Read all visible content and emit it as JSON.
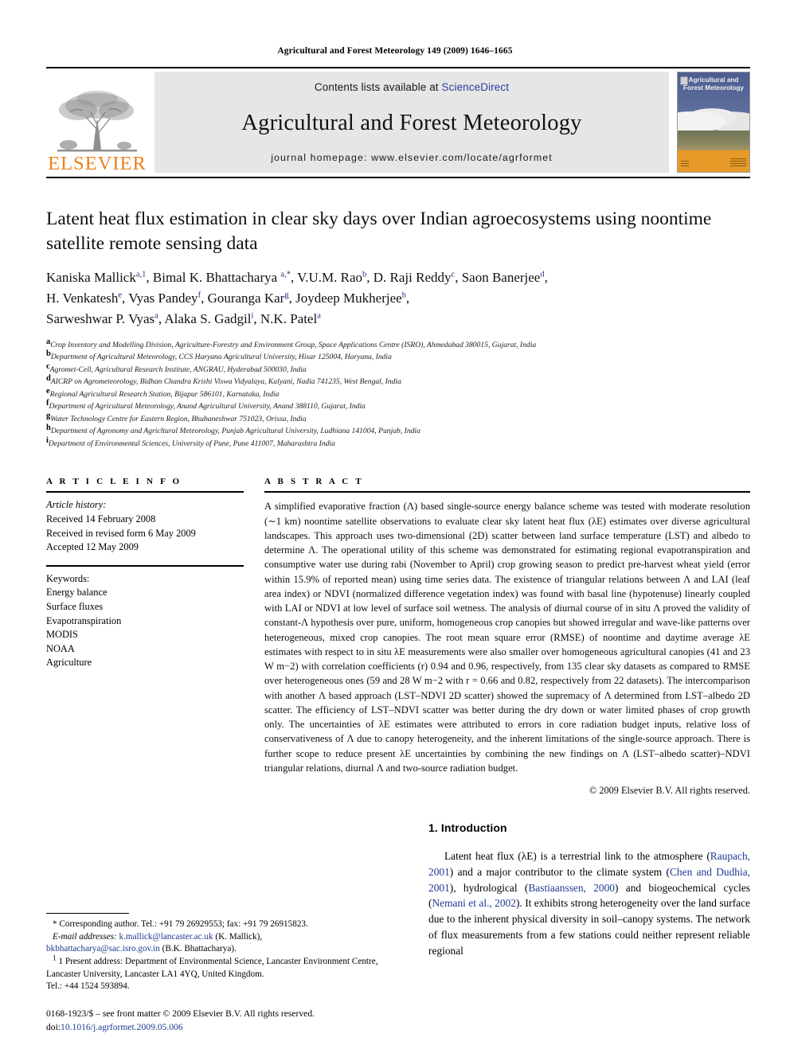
{
  "running_head": "Agricultural and Forest Meteorology 149 (2009) 1646–1665",
  "masthead": {
    "publisher": "ELSEVIER",
    "contents_prefix": "Contents lists available at ",
    "contents_link": "ScienceDirect",
    "journal_name": "Agricultural and Forest Meteorology",
    "homepage": "journal homepage: www.elsevier.com/locate/agrformet",
    "cover_title": "Agricultural and Forest Meteorology"
  },
  "title": "Latent heat flux estimation in clear sky days over Indian agroecosystems using noontime satellite remote sensing data",
  "authors_lines": [
    "Kaniska Mallick a,1, Bimal K. Bhattacharya a,*, V.U.M. Rao b, D. Raji Reddy c, Saon Banerjee d,",
    "H. Venkatesh e, Vyas Pandey f, Gouranga Kar g, Joydeep Mukherjee h,",
    "Sarweshwar P. Vyas a, Alaka S. Gadgil i, N.K. Patel a"
  ],
  "affiliations": [
    {
      "mark": "a",
      "text": "Crop Inventory and Modelling Division, Agriculture-Forestry and Environment Group, Space Applications Centre (ISRO), Ahmedabad 380015, Gujarat, India"
    },
    {
      "mark": "b",
      "text": "Department of Agricultural Meteorology, CCS Haryana Agricultural University, Hisar 125004, Haryana, India"
    },
    {
      "mark": "c",
      "text": "Agromet-Cell, Agricultural Research Institute, ANGRAU, Hyderabad 500030, India"
    },
    {
      "mark": "d",
      "text": "AICRP on Agrometeorology, Bidhan Chandra Krishi Viswa Vidyalaya, Kalyani, Nadia 741235, West Bengal, India"
    },
    {
      "mark": "e",
      "text": "Regional Agricultural Research Station, Bijapur 586101, Karnataka, India"
    },
    {
      "mark": "f",
      "text": "Department of Agricultural Meteorology, Anand Agricultural University, Anand 388110, Gujarat, India"
    },
    {
      "mark": "g",
      "text": "Water Technology Centre for Eastern Region, Bhubaneshwar 751023, Orissa, India"
    },
    {
      "mark": "h",
      "text": "Department of Agronomy and Agricltural Meteorology, Punjab Agricultural University, Ludhiana 141004, Punjab, India"
    },
    {
      "mark": "i",
      "text": "Department of Environmental Sciences, University of Pune, Pune 411007, Maharashtra India"
    }
  ],
  "article_info": {
    "heading": "A R T I C L E  I N F O",
    "history_label": "Article history:",
    "history": [
      "Received 14 February 2008",
      "Received in revised form 6 May 2009",
      "Accepted 12 May 2009"
    ],
    "keywords_label": "Keywords:",
    "keywords": [
      "Energy balance",
      "Surface fluxes",
      "Evapotranspiration",
      "MODIS",
      "NOAA",
      "Agriculture"
    ]
  },
  "abstract": {
    "heading": "A B S T R A C T",
    "text": "A simplified evaporative fraction (Λ) based single-source energy balance scheme was tested with moderate resolution (∼1 km) noontime satellite observations to evaluate clear sky latent heat flux (λE) estimates over diverse agricultural landscapes. This approach uses two-dimensional (2D) scatter between land surface temperature (LST) and albedo to determine Λ. The operational utility of this scheme was demonstrated for estimating regional evapotranspiration and consumptive water use during rabi (November to April) crop growing season to predict pre-harvest wheat yield (error within 15.9% of reported mean) using time series data. The existence of triangular relations between Λ and LAI (leaf area index) or NDVI (normalized difference vegetation index) was found with basal line (hypotenuse) linearly coupled with LAI or NDVI at low level of surface soil wetness. The analysis of diurnal course of in situ Λ proved the validity of constant-Λ hypothesis over pure, uniform, homogeneous crop canopies but showed irregular and wave-like patterns over heterogeneous, mixed crop canopies. The root mean square error (RMSE) of noontime and daytime average λE estimates with respect to in situ λE measurements were also smaller over homogeneous agricultural canopies (41 and 23 W m−2) with correlation coefficients (r) 0.94 and 0.96, respectively, from 135 clear sky datasets as compared to RMSE over heterogeneous ones (59 and 28 W m−2 with r = 0.66 and 0.82, respectively from 22 datasets). The intercomparison with another Λ based approach (LST–NDVI 2D scatter) showed the supremacy of Λ determined from LST–albedo 2D scatter. The efficiency of LST–NDVI scatter was better during the dry down or water limited phases of crop growth only. The uncertainties of λE estimates were attributed to errors in core radiation budget inputs, relative loss of conservativeness of Λ due to canopy heterogeneity, and the inherent limitations of the single-source approach. There is further scope to reduce present λE uncertainties by combining the new findings on Λ (LST–albedo scatter)–NDVI triangular relations, diurnal Λ and two-source radiation budget.",
    "copyright": "© 2009 Elsevier B.V. All rights reserved."
  },
  "introduction": {
    "heading": "1. Introduction",
    "paragraph_parts": [
      "Latent heat flux (λE) is a terrestrial link to the atmosphere (",
      "Raupach, 2001",
      ") and a major contributor to the climate system (",
      "Chen and Dudhia, 2001",
      "), hydrological (",
      "Bastiaanssen, 2000",
      ") and biogeochemical cycles (",
      "Nemani et al., 2002",
      "). It exhibits strong heterogeneity over the land surface due to the inherent physical diversity in soil–canopy systems. The network of flux measurements from a few stations could neither represent reliable regional"
    ]
  },
  "footnotes": {
    "corresponding": "* Corresponding author. Tel.: +91 79 26929553; fax: +91 79 26915823.",
    "email_label": "E-mail addresses:",
    "email1": "k.mallick@lancaster.ac.uk",
    "email1_name": " (K. Mallick),",
    "email2": "bkbhattacharya@sac.isro.gov.in",
    "email2_name": " (B.K. Bhattacharya).",
    "present_address": "1 Present address: Department of Environmental Science, Lancaster Environment Centre, Lancaster University, Lancaster LA1 4YQ, United Kingdom.",
    "present_tel": "Tel.: +44 1524 593894."
  },
  "issn": {
    "line1": "0168-1923/$ – see front matter © 2009 Elsevier B.V. All rights reserved.",
    "doi_label": "doi:",
    "doi_value": "10.1016/j.agrformet.2009.05.006"
  },
  "colors": {
    "link": "#2b3f9e",
    "elsevier_orange": "#ee7f1a",
    "reference": "#1f3a93"
  }
}
